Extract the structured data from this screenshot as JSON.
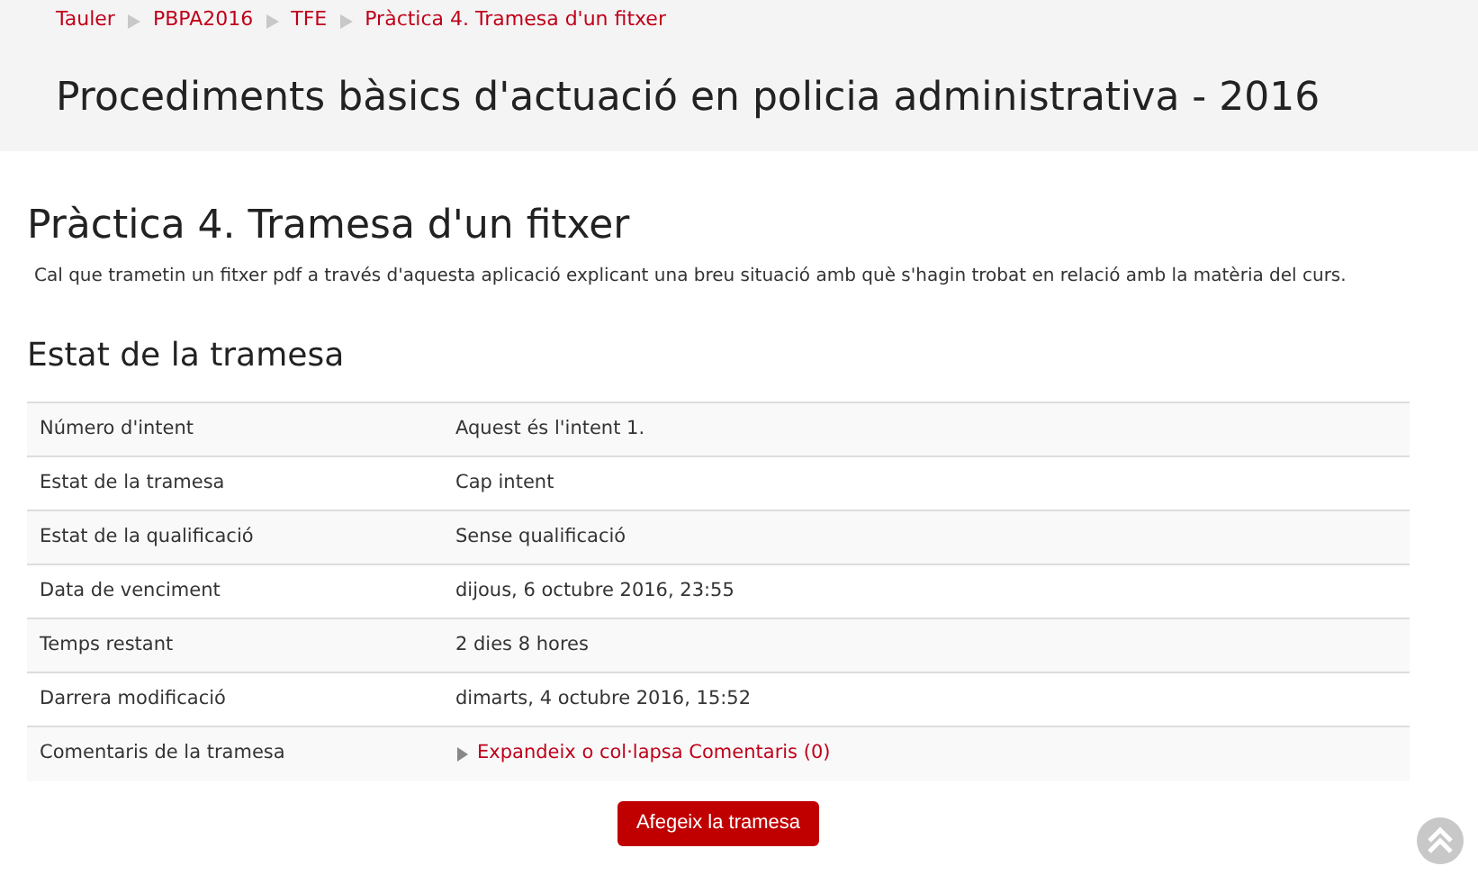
{
  "breadcrumb": [
    {
      "label": "Tauler"
    },
    {
      "label": "PBPA2016"
    },
    {
      "label": "TFE"
    },
    {
      "label": "Pràctica 4. Tramesa d'un fitxer"
    }
  ],
  "course_title": "Procediments bàsics d'actuació en policia administrativa - 2016",
  "page_title": "Pràctica 4. Tramesa d'un fitxer",
  "description": "Cal que trametin un fitxer pdf a través d'aquesta aplicació explicant una breu situació amb què s'hagin trobat en relació amb la matèria del curs.",
  "section_title": "Estat de la tramesa",
  "rows": [
    {
      "kind": "text",
      "label": "Número d'intent",
      "value": "Aquest és l'intent 1."
    },
    {
      "kind": "text",
      "label": "Estat de la tramesa",
      "value": "Cap intent"
    },
    {
      "kind": "text",
      "label": "Estat de la qualificació",
      "value": "Sense qualificació"
    },
    {
      "kind": "text",
      "label": "Data de venciment",
      "value": "dijous, 6 octubre 2016, 23:55"
    },
    {
      "kind": "text",
      "label": "Temps restant",
      "value": "2 dies 8 hores"
    },
    {
      "kind": "text",
      "label": "Darrera modificació",
      "value": "dimarts, 4 octubre 2016, 15:52"
    },
    {
      "kind": "toggle",
      "label": "Comentaris de la tramesa",
      "value": "Expandeix o col·lapsa Comentaris (0)",
      "expanded": false
    }
  ],
  "button": "Afegeix la tramesa"
}
